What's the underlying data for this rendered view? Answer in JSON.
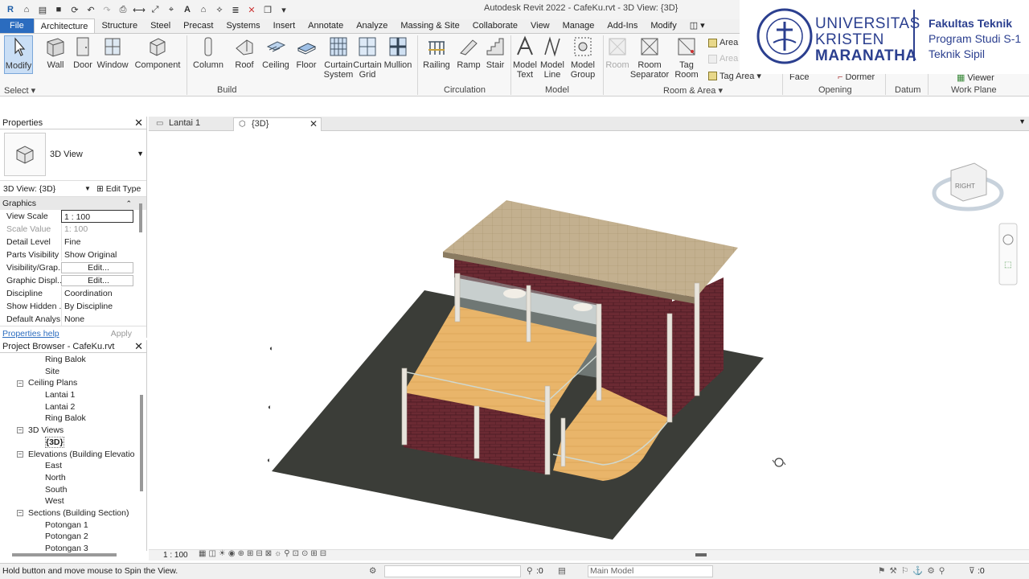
{
  "app": {
    "title": "Autodesk Revit 2022 - CafeKu.rvt - 3D View: {3D}"
  },
  "tabs": [
    "File",
    "Architecture",
    "Structure",
    "Steel",
    "Precast",
    "Systems",
    "Insert",
    "Annotate",
    "Analyze",
    "Massing & Site",
    "Collaborate",
    "View",
    "Manage",
    "Add-Ins",
    "Modify"
  ],
  "ribbon": {
    "tools": {
      "modify": "Modify",
      "wall": "Wall",
      "door": "Door",
      "window": "Window",
      "component": "Component",
      "column": "Column",
      "roof": "Roof",
      "ceiling": "Ceiling",
      "floor": "Floor",
      "curtain_system": "Curtain System",
      "curtain_grid": "Curtain Grid",
      "mullion": "Mullion",
      "railing": "Railing",
      "ramp": "Ramp",
      "stair": "Stair",
      "model_text": "Model Text",
      "model_line": "Model Line",
      "model_group": "Model Group",
      "room": "Room",
      "room_separator": "Room Separator",
      "tag_room": "Tag Room",
      "area": "Area",
      "area2": "Area",
      "tag_area": "Tag Area",
      "face": "Face",
      "dormer": "Dormer",
      "viewer": "Viewer"
    },
    "groups": {
      "select": "Select",
      "build": "Build",
      "circulation": "Circulation",
      "model": "Model",
      "room_area": "Room & Area",
      "opening": "Opening",
      "datum": "Datum",
      "work_plane": "Work Plane"
    }
  },
  "logo": {
    "line1": "UNIVERSITAS",
    "line2": "KRISTEN",
    "line3": "MARANATHA",
    "faculty": "Fakultas Teknik",
    "program": "Program Studi S-1",
    "dept": "Teknik Sipil",
    "seal_text": "UNIVERSITAS KRISTEN MARANATHA BANDUNG"
  },
  "view_tabs": [
    {
      "label": "Lantai 1"
    },
    {
      "label": "{3D}"
    }
  ],
  "properties": {
    "title": "Properties",
    "type": "3D View",
    "selector": "3D View: {3D}",
    "edit_type": "Edit Type",
    "section": "Graphics",
    "rows": [
      {
        "key": "View Scale",
        "value": "1 : 100"
      },
      {
        "key": "Scale Value",
        "value": "1: 100"
      },
      {
        "key": "Detail Level",
        "value": "Fine"
      },
      {
        "key": "Parts Visibility",
        "value": "Show Original"
      },
      {
        "key": "Visibility/Grap...",
        "value": "Edit..."
      },
      {
        "key": "Graphic Displ...",
        "value": "Edit..."
      },
      {
        "key": "Discipline",
        "value": "Coordination"
      },
      {
        "key": "Show Hidden ...",
        "value": "By Discipline"
      },
      {
        "key": "Default Analys...",
        "value": "None"
      }
    ],
    "help": "Properties help",
    "apply": "Apply"
  },
  "browser": {
    "title": "Project Browser - CafeKu.rvt",
    "items": [
      {
        "label": "Ring Balok",
        "level": 2
      },
      {
        "label": "Site",
        "level": 2
      },
      {
        "label": "Ceiling Plans",
        "level": 1
      },
      {
        "label": "Lantai 1",
        "level": 2
      },
      {
        "label": "Lantai 2",
        "level": 2
      },
      {
        "label": "Ring Balok",
        "level": 2
      },
      {
        "label": "3D Views",
        "level": 1
      },
      {
        "label": "{3D}",
        "level": 2
      },
      {
        "label": "Elevations (Building Elevatio",
        "level": 1
      },
      {
        "label": "East",
        "level": 2
      },
      {
        "label": "North",
        "level": 2
      },
      {
        "label": "South",
        "level": 2
      },
      {
        "label": "West",
        "level": 2
      },
      {
        "label": "Sections (Building Section)",
        "level": 1
      },
      {
        "label": "Potongan 1",
        "level": 2
      },
      {
        "label": "Potongan 2",
        "level": 2
      },
      {
        "label": "Potongan 3",
        "level": 2
      }
    ]
  },
  "viewcube": {
    "face": "RIGHT"
  },
  "viewbar": {
    "scale": "1 : 100"
  },
  "status": {
    "message": "Hold button and move mouse to Spin the View.",
    "model": "Main Model",
    "count1": ":0",
    "count2": ":0"
  }
}
